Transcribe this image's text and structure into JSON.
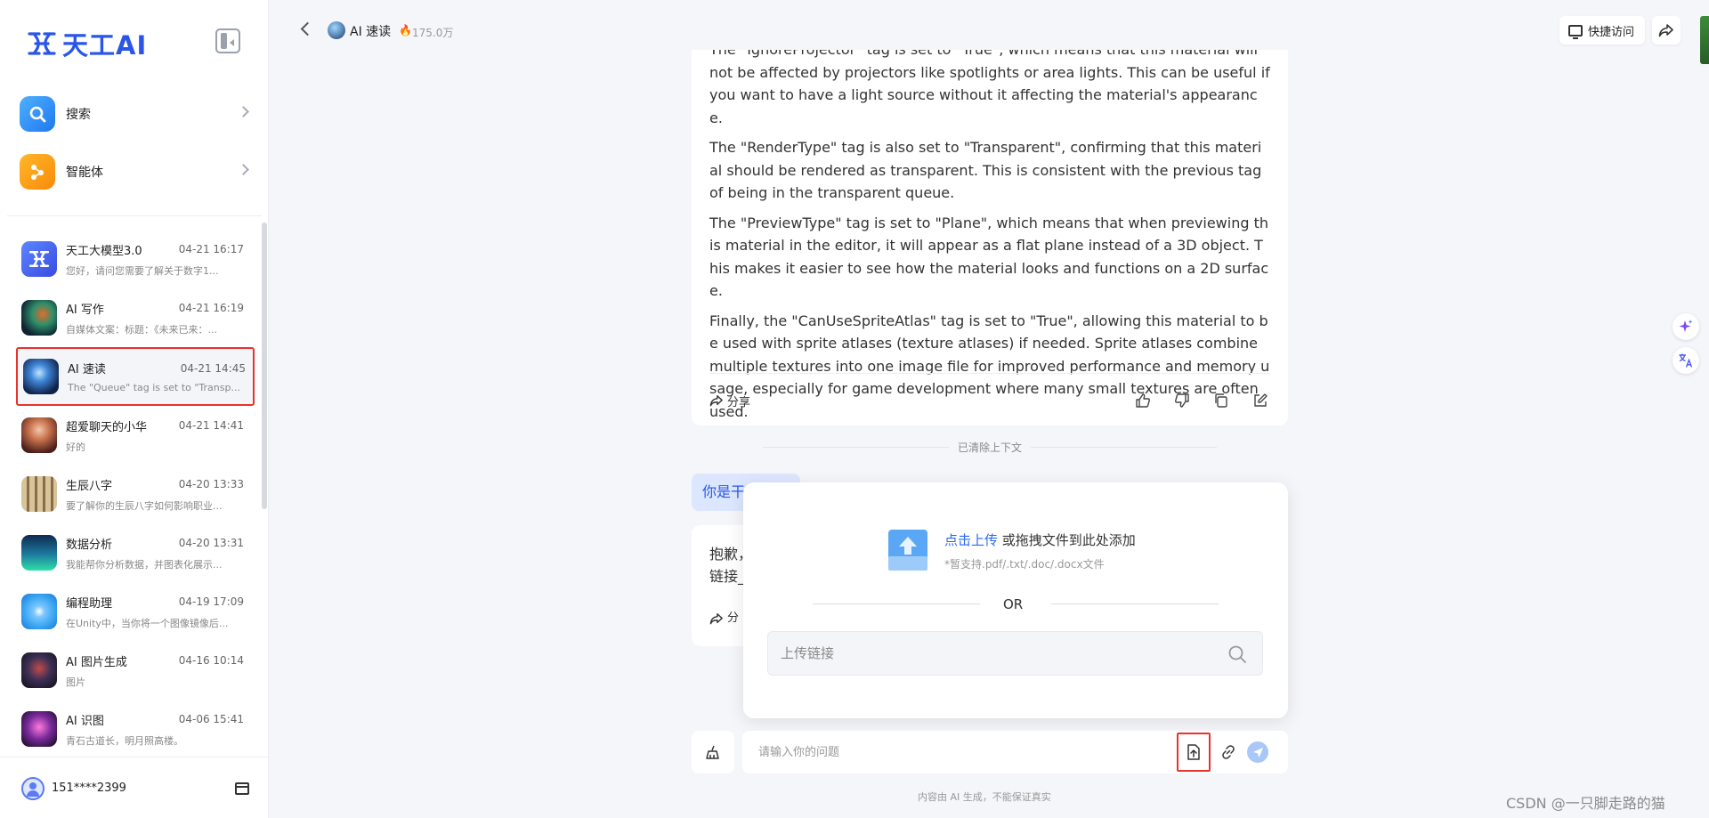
{
  "app": {
    "logo_text": "天工AI"
  },
  "nav": [
    {
      "label": "搜索",
      "icon": "search-icon",
      "color": "#2f8cf8"
    },
    {
      "label": "智能体",
      "icon": "agent-icon",
      "color": "#fa9b16"
    }
  ],
  "chats": [
    {
      "name": "天工大模型3.0",
      "time": "04-21 16:17",
      "preview": "您好，请问您需要了解关于数字1...",
      "avatar_color": "#4b6bf5"
    },
    {
      "name": "AI 写作",
      "time": "04-21 16:19",
      "preview": "自媒体文案：标题：《未来已来：...",
      "avatar_color": "#1d3d4a"
    },
    {
      "name": "AI 速读",
      "time": "04-21 14:45",
      "preview": "The \"Queue\" tag is set to \"Transp...",
      "avatar_color": "#1c3a78",
      "active": true
    },
    {
      "name": "超爱聊天的小华",
      "time": "04-21 14:41",
      "preview": "好的",
      "avatar_color": "#c8714d"
    },
    {
      "name": "生辰八字",
      "time": "04-20 13:33",
      "preview": "要了解你的生辰八字如何影响职业...",
      "avatar_color": "#a38a60"
    },
    {
      "name": "数据分析",
      "time": "04-20 13:31",
      "preview": "我能帮你分析数据，并图表化展示...",
      "avatar_color": "#1f7aa0"
    },
    {
      "name": "编程助理",
      "time": "04-19 17:09",
      "preview": "在Unity中，当你将一个图像镜像后...",
      "avatar_color": "#3aa6f0"
    },
    {
      "name": "AI 图片生成",
      "time": "04-16 10:14",
      "preview": "图片",
      "avatar_color": "#3c2f55"
    },
    {
      "name": "AI 识图",
      "time": "04-06 15:41",
      "preview": "青石古道长，明月照高楼。",
      "avatar_color": "#7a2a9c"
    }
  ],
  "user": {
    "name": "151****2399"
  },
  "header": {
    "title": "AI 速读",
    "count": "175.0万",
    "quick_access": "快捷访问"
  },
  "message": {
    "paragraphs": [
      "The \"IgnoreProjector\" tag is set to \"True\", which means that this material will not be affected by projectors like spotlights or area lights. This can be useful if you want to have a light source without it affecting the material's appearance.",
      "The \"RenderType\" tag is also set to \"Transparent\", confirming that this material should be rendered as transparent. This is consistent with the previous tag of being in the transparent queue.",
      "The \"PreviewType\" tag is set to \"Plane\", which means that when previewing this material in the editor, it will appear as a flat plane instead of a 3D object. This makes it easier to see how the material looks and functions on a 2D surface.",
      "Finally, the \"CanUseSpriteAtlas\" tag is set to \"True\", allowing this material to be used with sprite atlases (texture atlases) if needed. Sprite atlases combine multiple textures into one image file for improved performance and memory usage, especially for game development where many small textures are often used."
    ],
    "share_label": "分享"
  },
  "context_cleared": "已清除上下文",
  "user_message": "你是干",
  "reply": {
    "line1": "抱歉，",
    "line2": "链接_",
    "share_label": "分"
  },
  "upload": {
    "link_text": "点击上传",
    "rest_text": " 或拖拽文件到此处添加",
    "hint": "*暂支持.pdf/.txt/.doc/.docx文件",
    "or_text": "OR",
    "url_placeholder": "上传链接"
  },
  "input": {
    "placeholder": "请输入你的问题"
  },
  "disclaimer": "内容由 AI 生成，不能保证真实",
  "watermark": "CSDN @一只脚走路的猫"
}
